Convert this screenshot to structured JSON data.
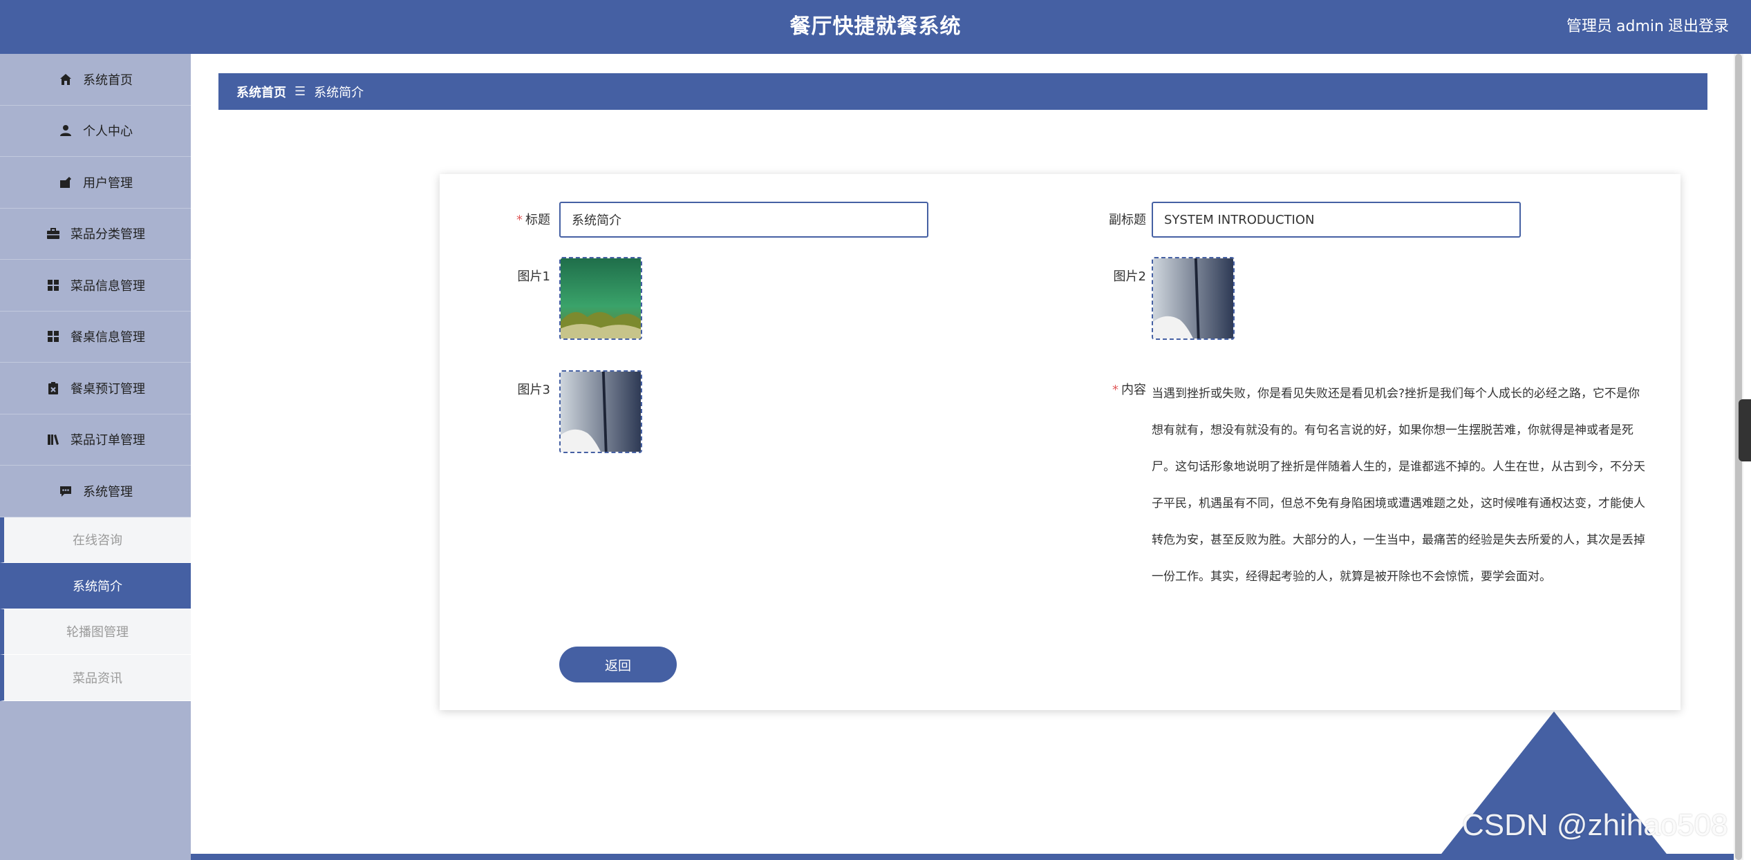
{
  "header": {
    "title": "餐厅快捷就餐系统",
    "role": "管理员",
    "username": "admin",
    "logout": "退出登录"
  },
  "sidebar": {
    "items": [
      {
        "label": "系统首页",
        "icon": "home-icon"
      },
      {
        "label": "个人中心",
        "icon": "user-icon"
      },
      {
        "label": "用户管理",
        "icon": "user-manage-icon"
      },
      {
        "label": "菜品分类管理",
        "icon": "briefcase-icon"
      },
      {
        "label": "菜品信息管理",
        "icon": "grid-icon"
      },
      {
        "label": "餐桌信息管理",
        "icon": "grid-icon"
      },
      {
        "label": "餐桌预订管理",
        "icon": "clipboard-icon"
      },
      {
        "label": "菜品订单管理",
        "icon": "orders-icon"
      },
      {
        "label": "系统管理",
        "icon": "chat-icon"
      }
    ],
    "subitems": [
      {
        "label": "在线咨询"
      },
      {
        "label": "系统简介",
        "active": true
      },
      {
        "label": "轮播图管理"
      },
      {
        "label": "菜品资讯"
      }
    ]
  },
  "breadcrumb": {
    "home": "系统首页",
    "separator": "☰",
    "current": "系统简介"
  },
  "form": {
    "title_label": "标题",
    "title_value": "系统简介",
    "subtitle_label": "副标题",
    "subtitle_value": "SYSTEM INTRODUCTION",
    "image1_label": "图片1",
    "image2_label": "图片2",
    "image3_label": "图片3",
    "content_label": "内容",
    "content_value": "当遇到挫折或失败，你是看见失败还是看见机会?挫折是我们每个人成长的必经之路，它不是你想有就有，想没有就没有的。有句名言说的好，如果你想一生摆脱苦难，你就得是神或者是死尸。这句话形象地说明了挫折是伴随着人生的，是谁都逃不掉的。人生在世，从古到今，不分天子平民，机遇虽有不同，但总不免有身陷困境或遭遇难题之处，这时候唯有通权达变，才能使人转危为安，甚至反败为胜。大部分的人，一生当中，最痛苦的经验是失去所爱的人，其次是丢掉一份工作。其实，经得起考验的人，就算是被开除也不会惊慌，要学会面对。",
    "back_button": "返回"
  },
  "watermark": "CSDN @zhihao508",
  "colors": {
    "primary": "#4560a3",
    "sidebar_bg": "#a9b2cf",
    "required": "#e05a5a"
  }
}
